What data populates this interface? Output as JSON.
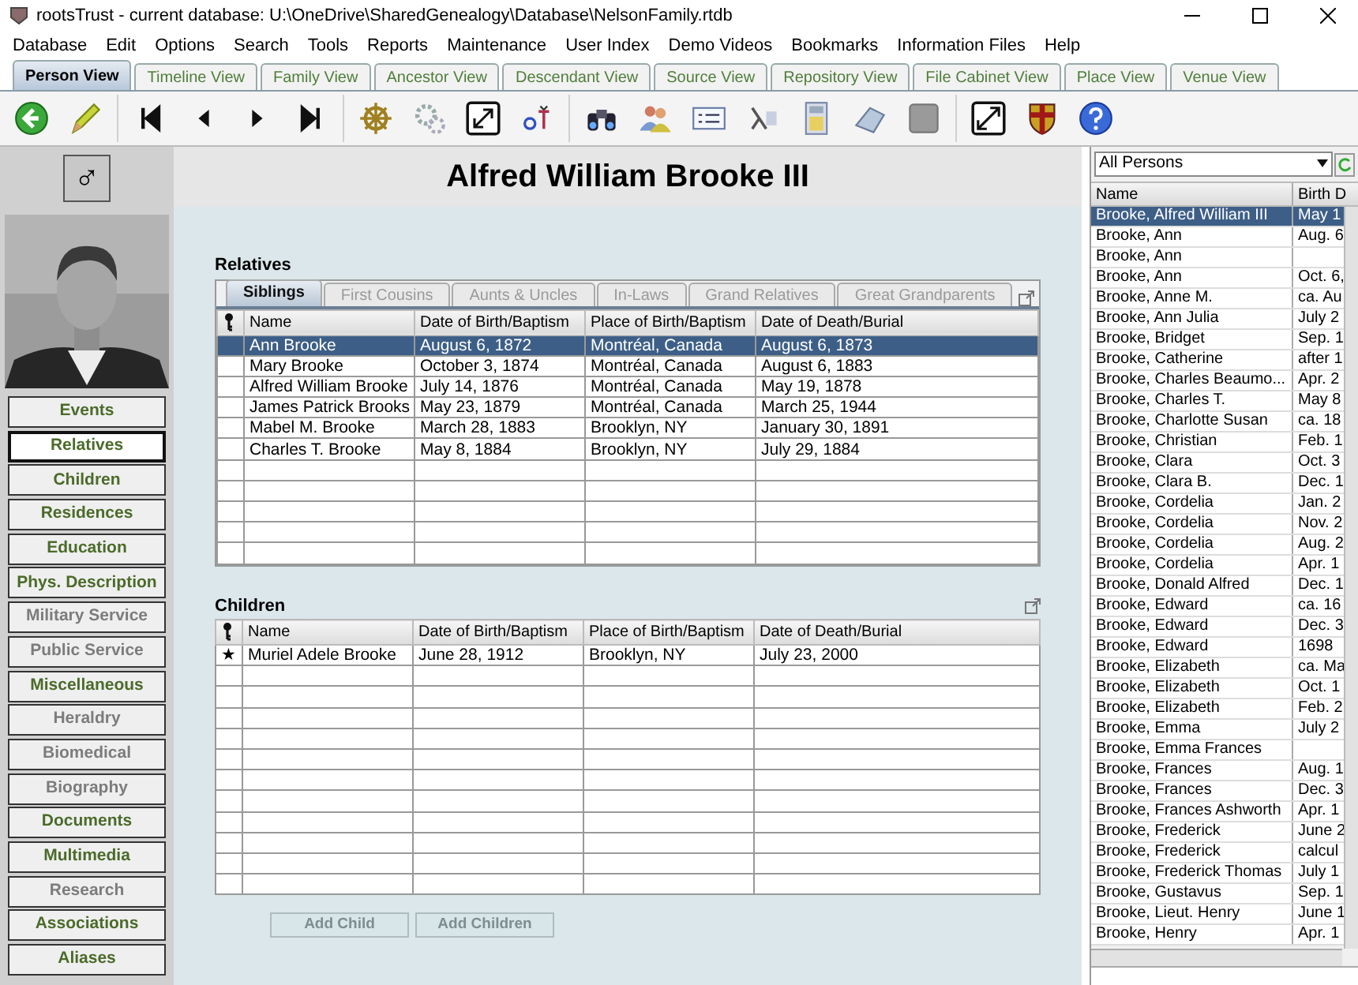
{
  "window": {
    "title": "rootsTrust - current database: U:\\OneDrive\\SharedGenealogy\\Database\\NelsonFamily.rtdb"
  },
  "menu": [
    "Database",
    "Edit",
    "Options",
    "Search",
    "Tools",
    "Reports",
    "Maintenance",
    "User Index",
    "Demo Videos",
    "Bookmarks",
    "Information Files",
    "Help"
  ],
  "view_tabs": [
    {
      "label": "Person View",
      "selected": true
    },
    {
      "label": "Timeline View",
      "selected": false
    },
    {
      "label": "Family View",
      "selected": false
    },
    {
      "label": "Ancestor View",
      "selected": false
    },
    {
      "label": "Descendant View",
      "selected": false
    },
    {
      "label": "Source View",
      "selected": false
    },
    {
      "label": "Repository View",
      "selected": false
    },
    {
      "label": "File Cabinet View",
      "selected": false
    },
    {
      "label": "Place View",
      "selected": false
    },
    {
      "label": "Venue View",
      "selected": false
    }
  ],
  "person": {
    "gender_symbol": "♂",
    "name": "Alfred William Brooke III"
  },
  "sections": [
    {
      "label": "Events",
      "selected": false,
      "has_data": true
    },
    {
      "label": "Relatives",
      "selected": true,
      "has_data": true
    },
    {
      "label": "Children",
      "selected": false,
      "has_data": true
    },
    {
      "label": "Residences",
      "selected": false,
      "has_data": true
    },
    {
      "label": "Education",
      "selected": false,
      "has_data": true
    },
    {
      "label": "Phys. Description",
      "selected": false,
      "has_data": true
    },
    {
      "label": "Military Service",
      "selected": false,
      "has_data": false
    },
    {
      "label": "Public Service",
      "selected": false,
      "has_data": false
    },
    {
      "label": "Miscellaneous",
      "selected": false,
      "has_data": true
    },
    {
      "label": "Heraldry",
      "selected": false,
      "has_data": false
    },
    {
      "label": "Biomedical",
      "selected": false,
      "has_data": false
    },
    {
      "label": "Biography",
      "selected": false,
      "has_data": false
    },
    {
      "label": "Documents",
      "selected": false,
      "has_data": true
    },
    {
      "label": "Multimedia",
      "selected": false,
      "has_data": true
    },
    {
      "label": "Research",
      "selected": false,
      "has_data": false
    },
    {
      "label": "Associations",
      "selected": false,
      "has_data": true
    },
    {
      "label": "Aliases",
      "selected": false,
      "has_data": true
    }
  ],
  "relatives": {
    "title": "Relatives",
    "tabs": [
      {
        "label": "Siblings",
        "selected": true
      },
      {
        "label": "First Cousins",
        "selected": false
      },
      {
        "label": "Aunts & Uncles",
        "selected": false
      },
      {
        "label": "In-Laws",
        "selected": false
      },
      {
        "label": "Grand Relatives",
        "selected": false
      },
      {
        "label": "Great Grandparents",
        "selected": false
      }
    ],
    "columns": [
      "Name",
      "Date of Birth/Baptism",
      "Place of Birth/Baptism",
      "Date of Death/Burial"
    ],
    "rows": [
      {
        "cells": [
          "Ann Brooke",
          "August 6, 1872",
          "Montréal, Canada",
          "August 6, 1873"
        ],
        "selected": true
      },
      {
        "cells": [
          "Mary Brooke",
          "October 3, 1874",
          "Montréal, Canada",
          "August 6, 1883"
        ],
        "selected": false
      },
      {
        "cells": [
          "Alfred William Brooke",
          "July 14, 1876",
          "Montréal, Canada",
          "May 19, 1878"
        ],
        "selected": false
      },
      {
        "cells": [
          "James Patrick Brooks",
          "May 23, 1879",
          "Montréal, Canada",
          "March 25, 1944"
        ],
        "selected": false
      },
      {
        "cells": [
          "Mabel M. Brooke",
          "March 28, 1883",
          "Brooklyn, NY",
          "January 30, 1891"
        ],
        "selected": false
      },
      {
        "cells": [
          "Charles T. Brooke",
          "May 8, 1884",
          "Brooklyn, NY",
          "July 29, 1884"
        ],
        "selected": false
      }
    ]
  },
  "children": {
    "title": "Children",
    "columns": [
      "Name",
      "Date of Birth/Baptism",
      "Place of Birth/Baptism",
      "Date of Death/Burial"
    ],
    "rows": [
      {
        "marker": "★",
        "cells": [
          "Muriel Adele Brooke",
          "June 28, 1912",
          "Brooklyn, NY",
          "July 23, 2000"
        ],
        "selected": false
      }
    ],
    "buttons": [
      {
        "label": "Add Child",
        "disabled": true
      },
      {
        "label": "Add Children",
        "disabled": true
      }
    ]
  },
  "person_list": {
    "filter": "All Persons",
    "columns": [
      "Name",
      "Birth D"
    ],
    "rows": [
      {
        "name": "Brooke, Alfred William III",
        "birth": "May 1",
        "selected": true
      },
      {
        "name": "Brooke, Ann",
        "birth": "Aug. 6",
        "selected": false
      },
      {
        "name": "Brooke, Ann",
        "birth": "",
        "selected": false
      },
      {
        "name": "Brooke, Ann",
        "birth": "Oct. 6,",
        "selected": false
      },
      {
        "name": "Brooke, Anne M.",
        "birth": "ca. Au",
        "selected": false
      },
      {
        "name": "Brooke, Ann Julia",
        "birth": "July 2",
        "selected": false
      },
      {
        "name": "Brooke, Bridget",
        "birth": "Sep. 1",
        "selected": false
      },
      {
        "name": "Brooke, Catherine",
        "birth": "after 1",
        "selected": false
      },
      {
        "name": "Brooke, Charles Beaumo...",
        "birth": "Apr. 2",
        "selected": false
      },
      {
        "name": "Brooke, Charles T.",
        "birth": "May 8",
        "selected": false
      },
      {
        "name": "Brooke, Charlotte Susan",
        "birth": "ca. 18",
        "selected": false
      },
      {
        "name": "Brooke, Christian",
        "birth": "Feb. 1",
        "selected": false
      },
      {
        "name": "Brooke, Clara",
        "birth": "Oct. 3",
        "selected": false
      },
      {
        "name": "Brooke, Clara B.",
        "birth": "Dec. 1",
        "selected": false
      },
      {
        "name": "Brooke, Cordelia",
        "birth": "Jan. 2",
        "selected": false
      },
      {
        "name": "Brooke, Cordelia",
        "birth": "Nov. 2",
        "selected": false
      },
      {
        "name": "Brooke, Cordelia",
        "birth": "Aug. 2",
        "selected": false
      },
      {
        "name": "Brooke, Cordelia",
        "birth": "Apr. 1",
        "selected": false
      },
      {
        "name": "Brooke, Donald Alfred",
        "birth": "Dec. 1",
        "selected": false
      },
      {
        "name": "Brooke, Edward",
        "birth": "ca. 16",
        "selected": false
      },
      {
        "name": "Brooke, Edward",
        "birth": "Dec. 3",
        "selected": false
      },
      {
        "name": "Brooke, Edward",
        "birth": "1698",
        "selected": false
      },
      {
        "name": "Brooke, Elizabeth",
        "birth": "ca. Ma",
        "selected": false
      },
      {
        "name": "Brooke, Elizabeth",
        "birth": "Oct. 1",
        "selected": false
      },
      {
        "name": "Brooke, Elizabeth",
        "birth": "Feb. 2",
        "selected": false
      },
      {
        "name": "Brooke, Emma",
        "birth": "July 2",
        "selected": false
      },
      {
        "name": "Brooke, Emma Frances",
        "birth": "",
        "selected": false
      },
      {
        "name": "Brooke, Frances",
        "birth": "Aug. 1",
        "selected": false
      },
      {
        "name": "Brooke, Frances",
        "birth": "Dec. 3",
        "selected": false
      },
      {
        "name": "Brooke, Frances Ashworth",
        "birth": "Apr. 1",
        "selected": false
      },
      {
        "name": "Brooke, Frederick",
        "birth": "June 2",
        "selected": false
      },
      {
        "name": "Brooke, Frederick",
        "birth": "calcul",
        "selected": false
      },
      {
        "name": "Brooke, Frederick Thomas",
        "birth": "July 1",
        "selected": false
      },
      {
        "name": "Brooke, Gustavus",
        "birth": "Sep. 1",
        "selected": false
      },
      {
        "name": "Brooke, Lieut. Henry",
        "birth": "June 1",
        "selected": false
      },
      {
        "name": "Brooke, Henry",
        "birth": "Apr. 1",
        "selected": false
      }
    ]
  }
}
